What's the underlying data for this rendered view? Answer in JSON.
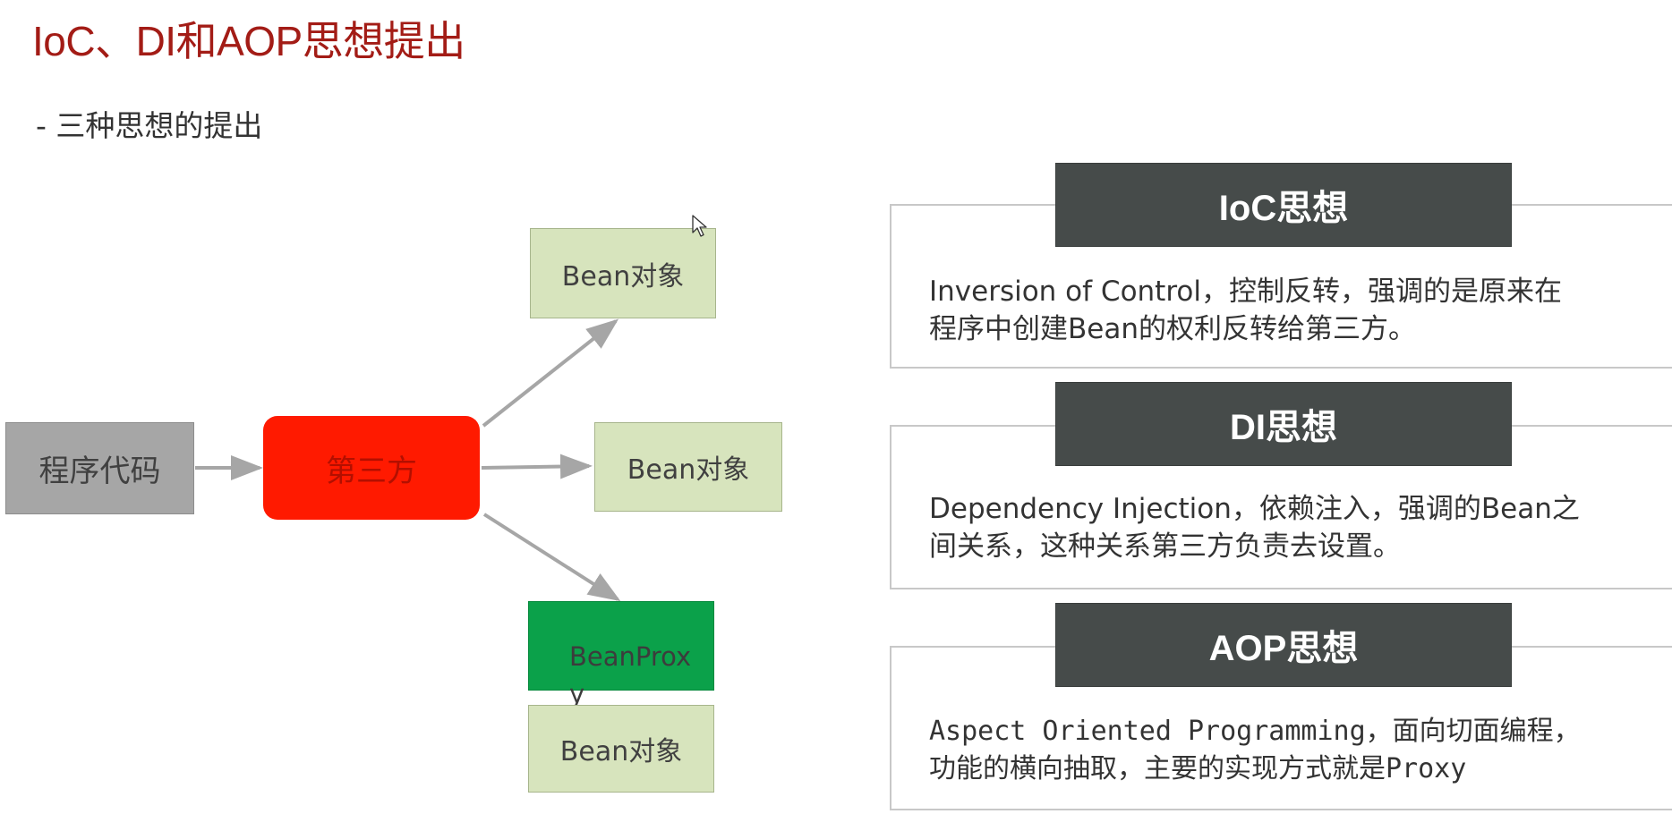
{
  "slide": {
    "title": "IoC、DI和AOP思想提出",
    "subtitle": "- 三种思想的提出"
  },
  "diagram": {
    "source": "程序代码",
    "third_party": "第三方",
    "bean_top": "Bean对象",
    "bean_middle": "Bean对象",
    "proxy": "BeanProxy",
    "bean_bottom": "Bean对象"
  },
  "cards": {
    "ioc": {
      "heading": "IoC思想",
      "line1": "Inversion of Control，控制反转，强调的是原来在",
      "line2": "程序中创建Bean的权利反转给第三方。"
    },
    "di": {
      "heading": "DI思想",
      "line1": "Dependency Injection，依赖注入，强调的Bean之",
      "line2": "间关系，这种关系第三方负责去设置。"
    },
    "aop": {
      "heading": "AOP思想",
      "line1": "Aspect Oriented Programming，面向切面编程，",
      "line2": "功能的横向抽取，主要的实现方式就是Proxy"
    }
  },
  "colors": {
    "title": "#a31c16",
    "third_party": "#ff1a00",
    "bean": "#d7e4bd",
    "proxy": "#0ba14a",
    "card_heading": "#464b4a",
    "arrow": "#a6a6a6"
  }
}
